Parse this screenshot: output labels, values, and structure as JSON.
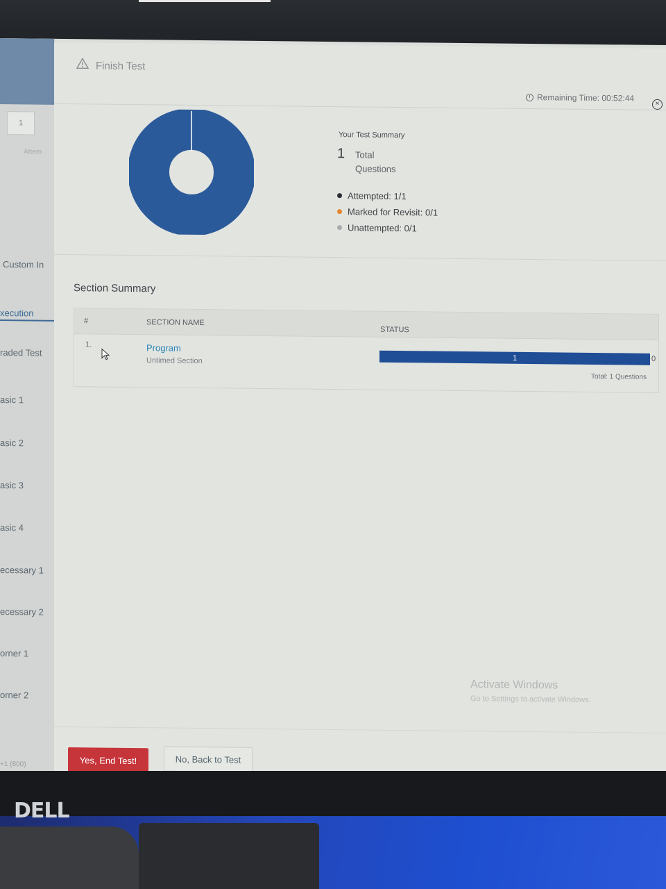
{
  "dialog": {
    "title": "Finish Test",
    "remaining_time_label": "Remaining Time: 00:52:44"
  },
  "summary": {
    "heading": "Your Test Summary",
    "total_count": "1",
    "total_label_line1": "Total",
    "total_label_line2": "Questions",
    "legend": [
      {
        "label": "Attempted: 1/1",
        "color": "#2a2e33"
      },
      {
        "label": "Marked for Revisit: 0/1",
        "color": "#e8862c"
      },
      {
        "label": "Unattempted: 0/1",
        "color": "#a9acad"
      }
    ],
    "donut_color": "#2b5a9a",
    "attempted_fraction": 1.0
  },
  "section_summary": {
    "title": "Section Summary",
    "columns": {
      "num": "#",
      "name": "SECTION NAME",
      "status": "STATUS"
    },
    "rows": [
      {
        "num": "1.",
        "name": "Program",
        "subtitle": "Untimed Section",
        "bar_value": "1",
        "bar_remaining": "0",
        "bar_total": "Total: 1 Questions",
        "attempted_fraction": 1.0
      }
    ]
  },
  "sidebar": {
    "question_number": "1",
    "attempt_label": "Attem",
    "items": [
      {
        "label": "Custom In"
      },
      {
        "label": "xecution"
      },
      {
        "label": "raded Test"
      },
      {
        "label": "asic 1"
      },
      {
        "label": "asic 2"
      },
      {
        "label": "asic 3"
      },
      {
        "label": "asic 4"
      },
      {
        "label": "ecessary 1"
      },
      {
        "label": "ecessary 2"
      },
      {
        "label": "orner 1"
      },
      {
        "label": "orner 2"
      }
    ],
    "footer": "+1 (800)"
  },
  "watermark": {
    "line1": "Activate Windows",
    "line2": "Go to Settings to activate Windows."
  },
  "buttons": {
    "end_test": "Yes, End Test!",
    "back_to_test": "No, Back to Test"
  },
  "monitor": {
    "brand": "DELL"
  }
}
